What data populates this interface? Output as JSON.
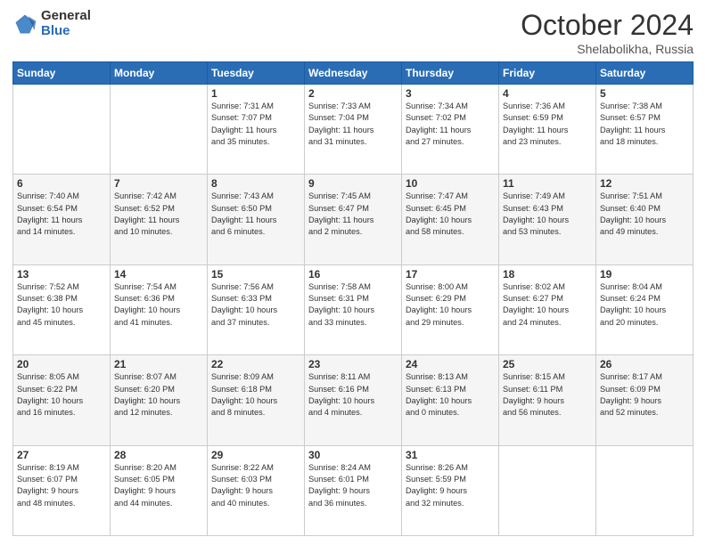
{
  "header": {
    "logo_general": "General",
    "logo_blue": "Blue",
    "month_title": "October 2024",
    "location": "Shelabolikha, Russia"
  },
  "weekdays": [
    "Sunday",
    "Monday",
    "Tuesday",
    "Wednesday",
    "Thursday",
    "Friday",
    "Saturday"
  ],
  "weeks": [
    [
      {
        "day": "",
        "info": ""
      },
      {
        "day": "",
        "info": ""
      },
      {
        "day": "1",
        "info": "Sunrise: 7:31 AM\nSunset: 7:07 PM\nDaylight: 11 hours\nand 35 minutes."
      },
      {
        "day": "2",
        "info": "Sunrise: 7:33 AM\nSunset: 7:04 PM\nDaylight: 11 hours\nand 31 minutes."
      },
      {
        "day": "3",
        "info": "Sunrise: 7:34 AM\nSunset: 7:02 PM\nDaylight: 11 hours\nand 27 minutes."
      },
      {
        "day": "4",
        "info": "Sunrise: 7:36 AM\nSunset: 6:59 PM\nDaylight: 11 hours\nand 23 minutes."
      },
      {
        "day": "5",
        "info": "Sunrise: 7:38 AM\nSunset: 6:57 PM\nDaylight: 11 hours\nand 18 minutes."
      }
    ],
    [
      {
        "day": "6",
        "info": "Sunrise: 7:40 AM\nSunset: 6:54 PM\nDaylight: 11 hours\nand 14 minutes."
      },
      {
        "day": "7",
        "info": "Sunrise: 7:42 AM\nSunset: 6:52 PM\nDaylight: 11 hours\nand 10 minutes."
      },
      {
        "day": "8",
        "info": "Sunrise: 7:43 AM\nSunset: 6:50 PM\nDaylight: 11 hours\nand 6 minutes."
      },
      {
        "day": "9",
        "info": "Sunrise: 7:45 AM\nSunset: 6:47 PM\nDaylight: 11 hours\nand 2 minutes."
      },
      {
        "day": "10",
        "info": "Sunrise: 7:47 AM\nSunset: 6:45 PM\nDaylight: 10 hours\nand 58 minutes."
      },
      {
        "day": "11",
        "info": "Sunrise: 7:49 AM\nSunset: 6:43 PM\nDaylight: 10 hours\nand 53 minutes."
      },
      {
        "day": "12",
        "info": "Sunrise: 7:51 AM\nSunset: 6:40 PM\nDaylight: 10 hours\nand 49 minutes."
      }
    ],
    [
      {
        "day": "13",
        "info": "Sunrise: 7:52 AM\nSunset: 6:38 PM\nDaylight: 10 hours\nand 45 minutes."
      },
      {
        "day": "14",
        "info": "Sunrise: 7:54 AM\nSunset: 6:36 PM\nDaylight: 10 hours\nand 41 minutes."
      },
      {
        "day": "15",
        "info": "Sunrise: 7:56 AM\nSunset: 6:33 PM\nDaylight: 10 hours\nand 37 minutes."
      },
      {
        "day": "16",
        "info": "Sunrise: 7:58 AM\nSunset: 6:31 PM\nDaylight: 10 hours\nand 33 minutes."
      },
      {
        "day": "17",
        "info": "Sunrise: 8:00 AM\nSunset: 6:29 PM\nDaylight: 10 hours\nand 29 minutes."
      },
      {
        "day": "18",
        "info": "Sunrise: 8:02 AM\nSunset: 6:27 PM\nDaylight: 10 hours\nand 24 minutes."
      },
      {
        "day": "19",
        "info": "Sunrise: 8:04 AM\nSunset: 6:24 PM\nDaylight: 10 hours\nand 20 minutes."
      }
    ],
    [
      {
        "day": "20",
        "info": "Sunrise: 8:05 AM\nSunset: 6:22 PM\nDaylight: 10 hours\nand 16 minutes."
      },
      {
        "day": "21",
        "info": "Sunrise: 8:07 AM\nSunset: 6:20 PM\nDaylight: 10 hours\nand 12 minutes."
      },
      {
        "day": "22",
        "info": "Sunrise: 8:09 AM\nSunset: 6:18 PM\nDaylight: 10 hours\nand 8 minutes."
      },
      {
        "day": "23",
        "info": "Sunrise: 8:11 AM\nSunset: 6:16 PM\nDaylight: 10 hours\nand 4 minutes."
      },
      {
        "day": "24",
        "info": "Sunrise: 8:13 AM\nSunset: 6:13 PM\nDaylight: 10 hours\nand 0 minutes."
      },
      {
        "day": "25",
        "info": "Sunrise: 8:15 AM\nSunset: 6:11 PM\nDaylight: 9 hours\nand 56 minutes."
      },
      {
        "day": "26",
        "info": "Sunrise: 8:17 AM\nSunset: 6:09 PM\nDaylight: 9 hours\nand 52 minutes."
      }
    ],
    [
      {
        "day": "27",
        "info": "Sunrise: 8:19 AM\nSunset: 6:07 PM\nDaylight: 9 hours\nand 48 minutes."
      },
      {
        "day": "28",
        "info": "Sunrise: 8:20 AM\nSunset: 6:05 PM\nDaylight: 9 hours\nand 44 minutes."
      },
      {
        "day": "29",
        "info": "Sunrise: 8:22 AM\nSunset: 6:03 PM\nDaylight: 9 hours\nand 40 minutes."
      },
      {
        "day": "30",
        "info": "Sunrise: 8:24 AM\nSunset: 6:01 PM\nDaylight: 9 hours\nand 36 minutes."
      },
      {
        "day": "31",
        "info": "Sunrise: 8:26 AM\nSunset: 5:59 PM\nDaylight: 9 hours\nand 32 minutes."
      },
      {
        "day": "",
        "info": ""
      },
      {
        "day": "",
        "info": ""
      }
    ]
  ]
}
